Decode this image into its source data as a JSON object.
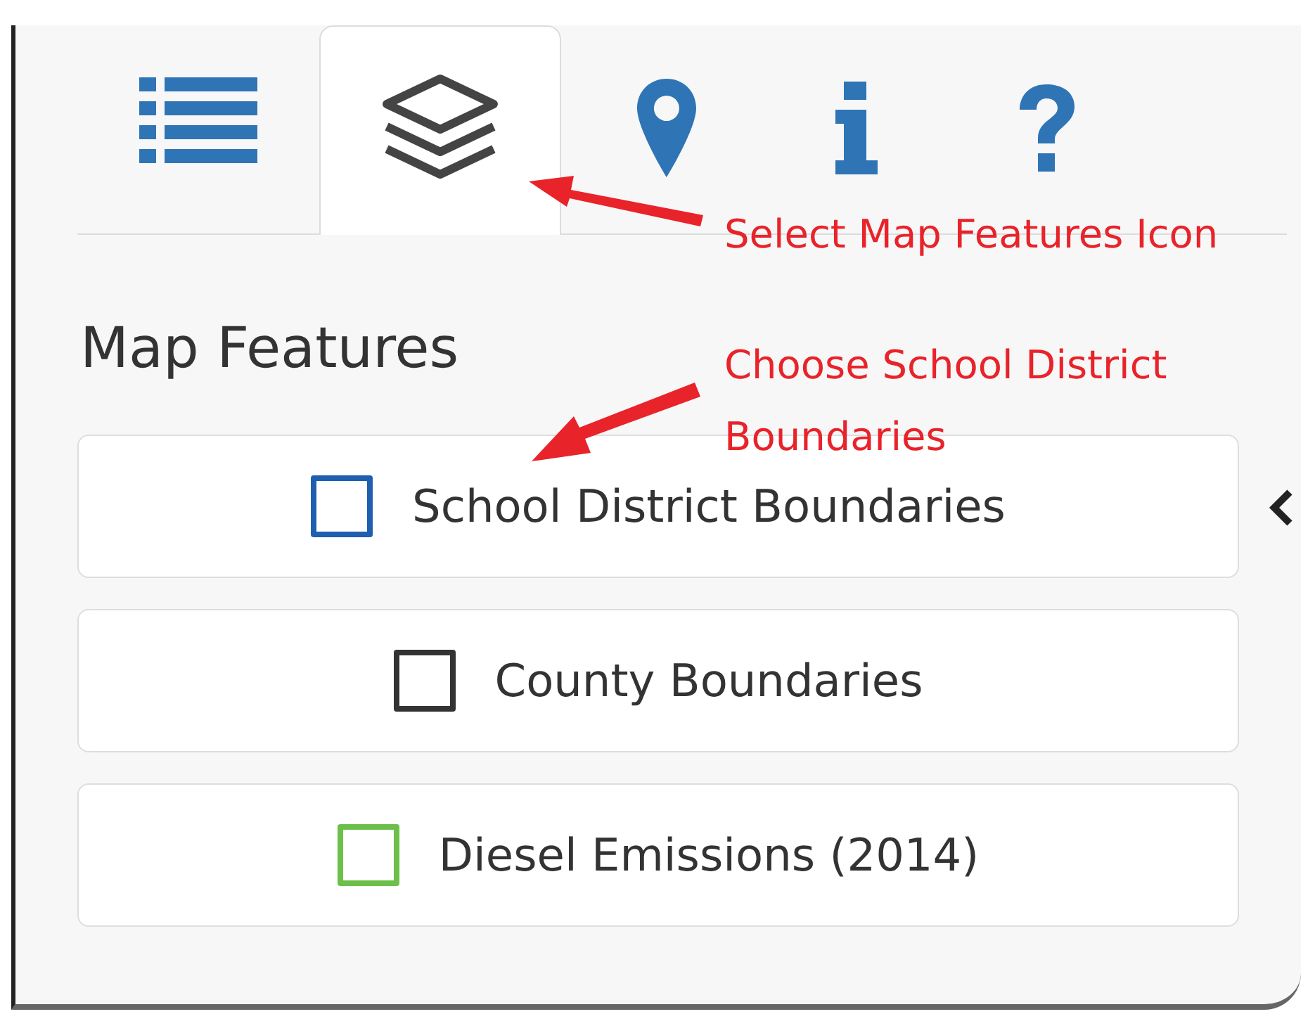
{
  "tabs": [
    {
      "kind": "list",
      "selected": false
    },
    {
      "kind": "layers",
      "selected": true
    },
    {
      "kind": "pin",
      "selected": false
    },
    {
      "kind": "info",
      "selected": false
    },
    {
      "kind": "help",
      "selected": false
    }
  ],
  "heading": "Map Features",
  "features": [
    {
      "label": "School District Boundaries",
      "checked": false,
      "color": "#1f5fb0"
    },
    {
      "label": "County Boundaries",
      "checked": false,
      "color": "#333333"
    },
    {
      "label": "Diesel Emissions (2014)",
      "checked": false,
      "color": "#6cc04a"
    }
  ],
  "annotations": [
    {
      "text": "Select Map Features Icon"
    },
    {
      "text": "Choose School District Boundaries"
    }
  ]
}
